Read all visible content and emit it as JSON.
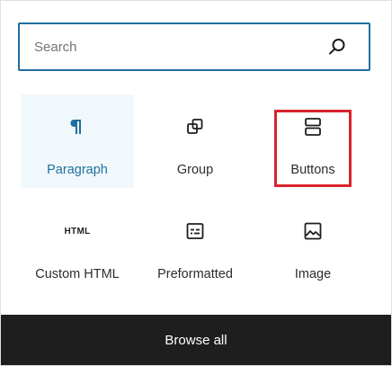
{
  "search": {
    "placeholder": "Search",
    "value": "",
    "border_color": "#1f6f9e",
    "icon": "search-icon"
  },
  "blocks": [
    {
      "label": "Paragraph",
      "icon": "paragraph-icon",
      "selected": true,
      "highlighted": false
    },
    {
      "label": "Group",
      "icon": "group-icon",
      "selected": false,
      "highlighted": false
    },
    {
      "label": "Buttons",
      "icon": "buttons-icon",
      "selected": false,
      "highlighted": true
    },
    {
      "label": "Custom HTML",
      "icon": "html-icon",
      "icon_text": "HTML",
      "selected": false,
      "highlighted": false
    },
    {
      "label": "Preformatted",
      "icon": "preformatted-icon",
      "selected": false,
      "highlighted": false
    },
    {
      "label": "Image",
      "icon": "image-icon",
      "selected": false,
      "highlighted": false
    }
  ],
  "footer": {
    "browse_all_label": "Browse all",
    "background": "#1e1e1e"
  },
  "colors": {
    "accent": "#1f6f9e",
    "selected_background": "#f1f8fc",
    "highlight": "#d9232e"
  }
}
